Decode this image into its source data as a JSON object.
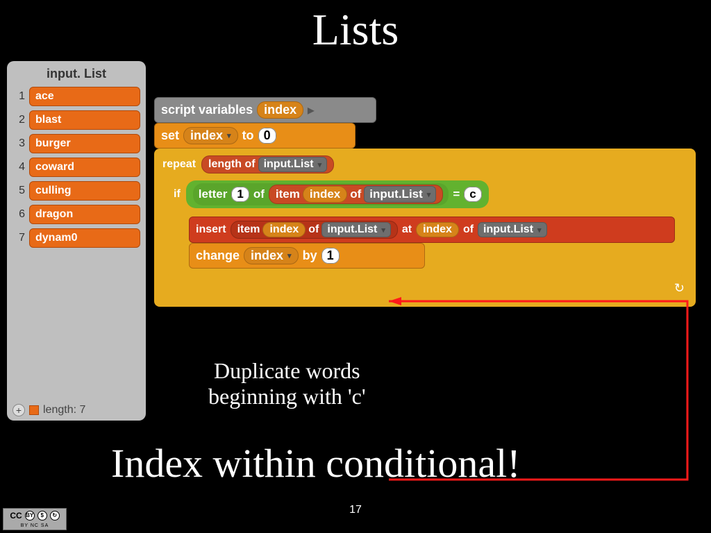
{
  "title": "Lists",
  "list_watcher": {
    "name": "input. List",
    "items": [
      "ace",
      "blast",
      "burger",
      "coward",
      "culling",
      "dragon",
      "dynam0"
    ],
    "length_label": "length: 7"
  },
  "script": {
    "script_vars_label": "script variables",
    "script_vars_var": "index",
    "set_label": "set",
    "set_var": "index",
    "to_label": "to",
    "set_value": "0",
    "repeat_label": "repeat",
    "length_of_label": "length of",
    "list_name": "input.List",
    "if_label": "if",
    "letter_label": "letter",
    "letter_num": "1",
    "of_label": "of",
    "item_label": "item",
    "index_var": "index",
    "equals": "=",
    "compare_char": "c",
    "insert_label": "insert",
    "at_label": "at",
    "change_label": "change",
    "by_label": "by",
    "change_value": "1"
  },
  "arrow_tri": "▶",
  "dropdown_arrow": "▾",
  "loop_arrow_glyph": "↻",
  "caption1_line1": "Duplicate words",
  "caption1_line2": "beginning with 'c'",
  "caption2": "Index within conditional!",
  "page_number": "17",
  "cc": {
    "label": "CC",
    "sub": "BY  NC  SA"
  }
}
